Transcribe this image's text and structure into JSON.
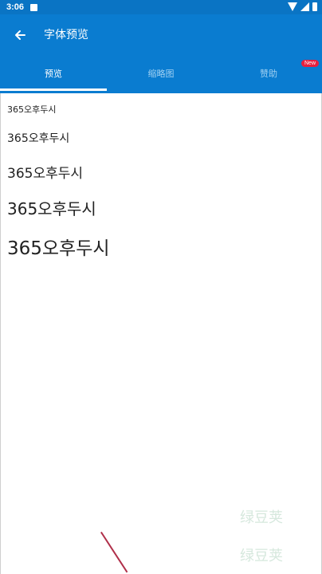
{
  "status_bar": {
    "time": "3:06"
  },
  "header": {
    "title": "字体预览",
    "back_icon": "arrow-left-icon"
  },
  "tabs": [
    {
      "label": "预览",
      "active": true
    },
    {
      "label": "缩略图",
      "active": false
    },
    {
      "label": "赞助",
      "active": false,
      "badge": "New"
    }
  ],
  "preview": {
    "lines": [
      "365오후두시",
      "365오후두시",
      "365오후두시",
      "365오후두시",
      "365오후두시"
    ]
  },
  "watermarks": [
    "绿豆荚",
    "绿豆荚"
  ],
  "colors": {
    "primary": "#0a7cd0",
    "status_bar": "#0a74c4",
    "badge": "#e8203f"
  }
}
